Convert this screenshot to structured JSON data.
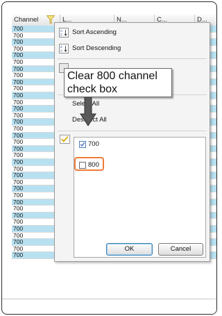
{
  "grid": {
    "headers": [
      "Channel",
      "L...",
      "N...",
      "C...",
      "D..."
    ],
    "row_value": "700",
    "row_count": 35,
    "colors": {
      "blue_row": "#b7e1f1",
      "white_row": "#ffffff"
    }
  },
  "filter_menu": {
    "items": [
      {
        "label": "Sort Ascending",
        "icon": "sort-ascending-icon"
      },
      {
        "label": "Sort Descending",
        "icon": "sort-descending-icon"
      },
      {
        "label": "Select All",
        "icon": ""
      },
      {
        "label": "Deselect All",
        "icon": ""
      }
    ],
    "values": [
      {
        "label": "700",
        "checked": true
      },
      {
        "label": "800",
        "checked": false
      }
    ],
    "ok_label": "OK",
    "cancel_label": "Cancel"
  },
  "callout": {
    "line1": "Clear 800 channel",
    "line2": "check box",
    "highlight_color": "#f07b3a"
  }
}
